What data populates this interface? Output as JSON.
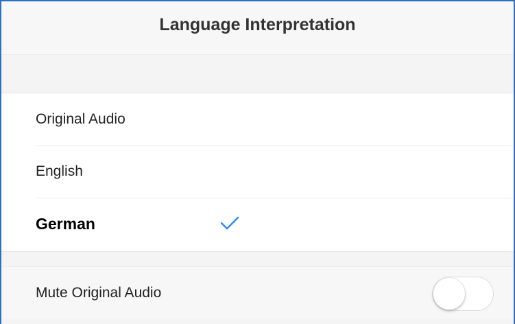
{
  "header": {
    "title": "Language Interpretation"
  },
  "options": [
    {
      "label": "Original Audio",
      "selected": false
    },
    {
      "label": "English",
      "selected": false
    },
    {
      "label": "German",
      "selected": true
    }
  ],
  "check_icon": "checkmark-icon",
  "mute": {
    "label": "Mute Original Audio",
    "enabled": false
  },
  "colors": {
    "accent": "#2d8cff",
    "frame_border": "#2f6fbf"
  }
}
